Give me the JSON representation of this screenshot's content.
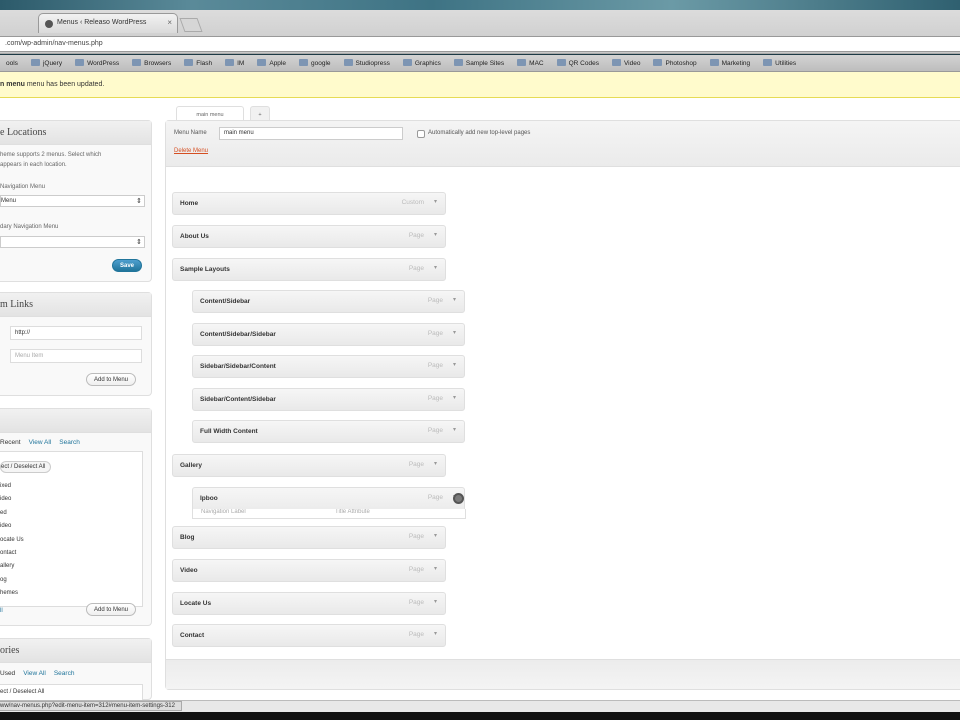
{
  "browser": {
    "tab_title": "Menus ‹ Releaso WordPress",
    "tab_close": "×",
    "url": ".com/wp-admin/nav-menus.php"
  },
  "bookmarks": [
    "ools",
    "jQuery",
    "WordPress",
    "Browsers",
    "Flash",
    "IM",
    "Apple",
    "google",
    "Studiopress",
    "Graphics",
    "Sample Sites",
    "MAC",
    "QR Codes",
    "Video",
    "Photoshop",
    "Marketing",
    "Utilities"
  ],
  "notice": {
    "bold": "n menu",
    "rest": " menu has been updated."
  },
  "locations": {
    "title": "e Locations",
    "desc1": "heme supports 2 menus. Select which",
    "desc2": "appears in each location.",
    "primary_label": "Navigation Menu",
    "primary_value": "Menu",
    "secondary_label": "dary Navigation Menu",
    "secondary_value": "",
    "save": "Save"
  },
  "custom_links": {
    "title": "m Links",
    "url_value": "http://",
    "label_placeholder": "Menu Item",
    "add": "Add to Menu"
  },
  "pages": {
    "tabs": [
      "Recent",
      "View All",
      "Search"
    ],
    "select_all": "ect / Deselect All",
    "items": [
      "ixed",
      "ideo",
      "ed",
      "ideo",
      "ocate Us",
      "ontact",
      "allery",
      "og",
      "hemes"
    ],
    "footer_link": "ll",
    "add": "Add to Menu"
  },
  "categories": {
    "title": "ories",
    "tabs": [
      "Used",
      "View All",
      "Search"
    ],
    "bottom": "ect / Deselect All"
  },
  "menu_tabs": {
    "active": "main menu",
    "add": "+"
  },
  "menu": {
    "name_label": "Menu Name",
    "name_value": "main menu",
    "auto_add": "Automatically add new top-level pages",
    "delete": "Delete Menu",
    "arrow": "▾",
    "items": [
      {
        "title": "Home",
        "type": "Custom"
      },
      {
        "title": "About Us",
        "type": "Page"
      },
      {
        "title": "Sample Layouts",
        "type": "Page"
      },
      {
        "title": "Content/Sidebar",
        "type": "Page"
      },
      {
        "title": "Content/Sidebar/Sidebar",
        "type": "Page"
      },
      {
        "title": "Sidebar/Sidebar/Content",
        "type": "Page"
      },
      {
        "title": "Sidebar/Content/Sidebar",
        "type": "Page"
      },
      {
        "title": "Full Width Content",
        "type": "Page"
      },
      {
        "title": "Gallery",
        "type": "Page"
      },
      {
        "title": "Ipboo",
        "type": "Page"
      },
      {
        "title": "Blog",
        "type": "Page"
      },
      {
        "title": "Video",
        "type": "Page"
      },
      {
        "title": "Locate Us",
        "type": "Page"
      },
      {
        "title": "Contact",
        "type": "Page"
      }
    ],
    "expanded_left": "Navigation Label",
    "expanded_right": "Title Attribute"
  },
  "status_url": "ww/nav-menus.php?edit-menu-item=312#menu-item-settings-312",
  "select_arrow": "⇕"
}
